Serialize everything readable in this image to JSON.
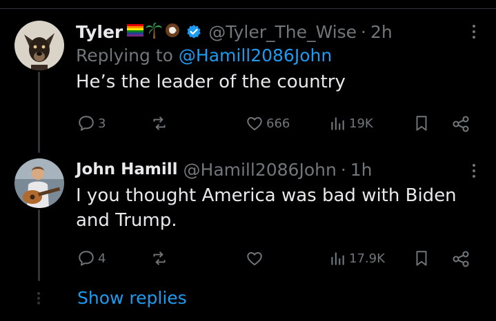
{
  "tweet1": {
    "name": "Tyler",
    "emoji_icons": [
      "rainbow-flag-icon",
      "palm-tree-icon",
      "coconut-icon"
    ],
    "verified_icon": "verified-badge-icon",
    "handle": "@Tyler_The_Wise",
    "separator": "·",
    "time": "2h",
    "replying_prefix": "Replying to",
    "replying_to": "@Hamill2086John",
    "text": "He’s the leader of the country",
    "replies": "3",
    "reposts": "",
    "likes": "666",
    "views": "19K"
  },
  "tweet2": {
    "name": "John Hamill",
    "handle": "@Hamill2086John",
    "separator": "·",
    "time": "1h",
    "text_line1": "I you thought America was bad with Biden",
    "text_line2": "and Trump.",
    "replies": "4",
    "reposts": "",
    "likes": "",
    "views": "17.9K"
  },
  "show_replies": "Show replies",
  "colors": {
    "background": "#000000",
    "text": "#e7e9ea",
    "muted": "#71767b",
    "link": "#1d9bf0",
    "thread_line": "#333639"
  },
  "icons": [
    "reply-icon",
    "repost-icon",
    "like-icon",
    "views-icon",
    "bookmark-icon",
    "share-icon",
    "more-icon"
  ]
}
